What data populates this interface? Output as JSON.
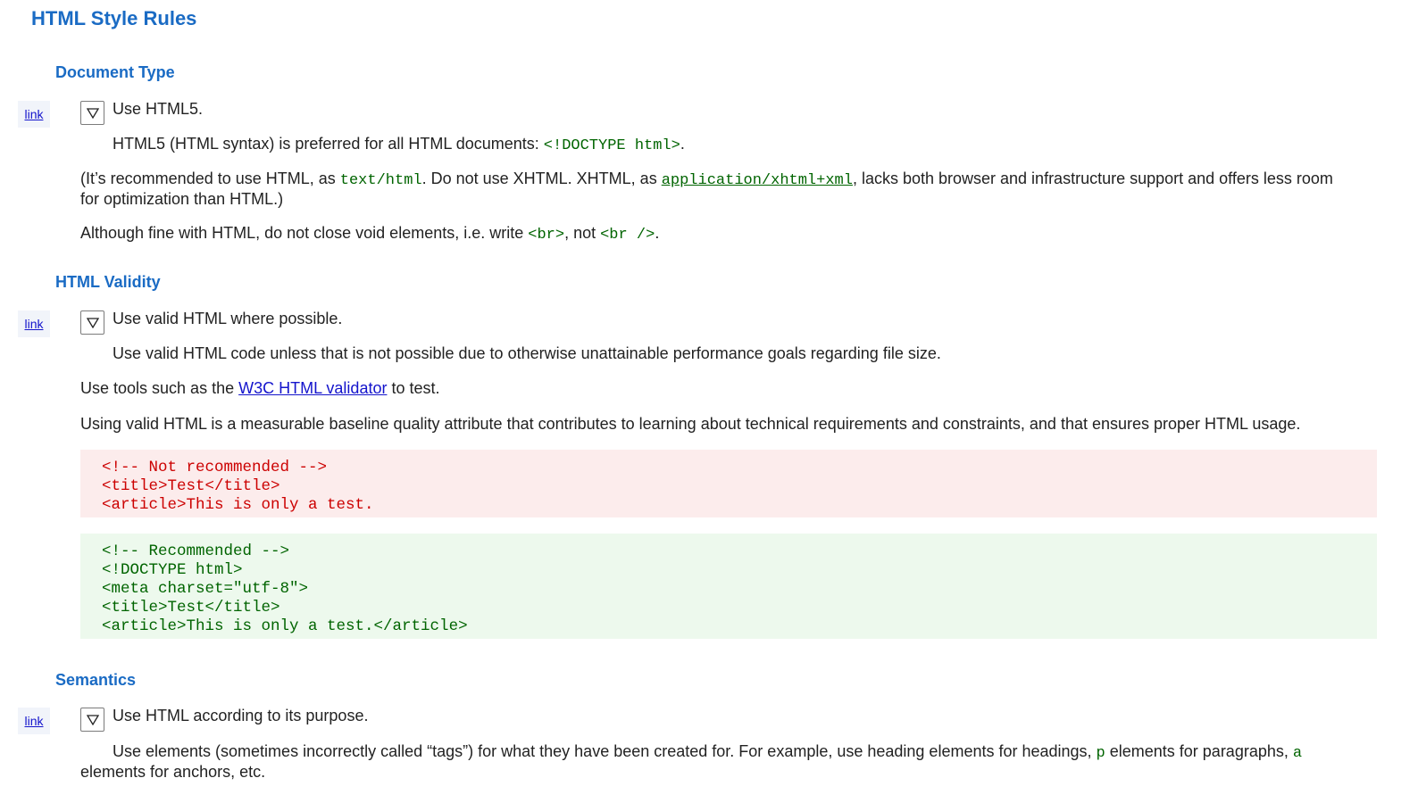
{
  "page": {
    "title": "HTML Style Rules"
  },
  "link_label": "link",
  "sections": [
    {
      "heading": "Document Type",
      "summary": "Use HTML5.",
      "detail": {
        "t1": "HTML5 (HTML syntax) is preferred for all HTML documents: ",
        "c1": "<!DOCTYPE html>",
        "t2": "."
      },
      "p1": {
        "t1": "(It’s recommended to use HTML, as ",
        "c1": "text/html",
        "t2": ". Do not use XHTML. XHTML, as ",
        "c2": "application/xhtml+xml",
        "t3": ", lacks both browser and infrastructure support and offers less room for optimization than HTML.)"
      },
      "p2": {
        "t1": "Although fine with HTML, do not close void elements, i.e. write ",
        "c1": "<br>",
        "t2": ", not ",
        "c2": "<br />",
        "t3": "."
      }
    },
    {
      "heading": "HTML Validity",
      "summary": "Use valid HTML where possible.",
      "detail": "Use valid HTML code unless that is not possible due to otherwise unattainable performance goals regarding file size.",
      "p1": {
        "t1": "Use tools such as the ",
        "link": "W3C HTML validator",
        "t2": " to test."
      },
      "p2": "Using valid HTML is a measurable baseline quality attribute that contributes to learning about technical requirements and constraints, and that ensures proper HTML usage.",
      "bad_code": [
        "<!-- Not recommended -->",
        "<title>Test</title>",
        "<article>This is only a test."
      ],
      "good_code": [
        "<!-- Recommended -->",
        "<!DOCTYPE html>",
        "<meta charset=\"utf-8\">",
        "<title>Test</title>",
        "<article>This is only a test.</article>"
      ]
    },
    {
      "heading": "Semantics",
      "summary": "Use HTML according to its purpose.",
      "detail": {
        "t1": "Use elements (sometimes incorrectly called “tags”) for what they have been created for. For example, use heading elements for headings, ",
        "c1": "p",
        "t2": " elements for paragraphs, ",
        "c2": "a",
        "t3": " elements for anchors, etc."
      }
    }
  ],
  "colors": {
    "heading": "#1a6bc4",
    "link": "#1414cc",
    "code": "#006400",
    "bad_bg": "#fcecec",
    "bad_text": "#cc0000",
    "good_bg": "#edf9ed",
    "good_text": "#006400"
  },
  "icons": {
    "toggle": "triangle-down-icon"
  }
}
